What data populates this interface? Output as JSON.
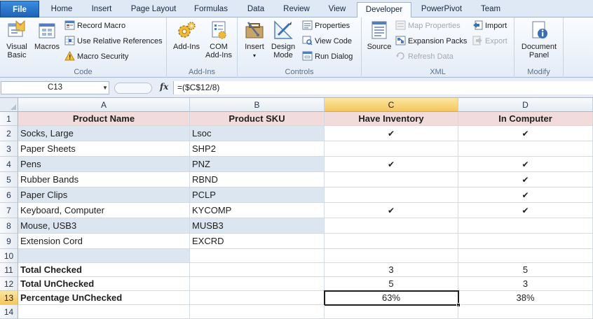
{
  "tabs": [
    "File",
    "Home",
    "Insert",
    "Page Layout",
    "Formulas",
    "Data",
    "Review",
    "View",
    "Developer",
    "PowerPivot",
    "Team"
  ],
  "active_tab": "Developer",
  "ribbon": {
    "code": {
      "label": "Code",
      "visual_basic": "Visual Basic",
      "visual_basic_line1": "Visual",
      "visual_basic_line2": "Basic",
      "macros": "Macros",
      "record_macro": "Record Macro",
      "use_relative": "Use Relative References",
      "macro_security": "Macro Security"
    },
    "addins": {
      "label": "Add-Ins",
      "addins": "Add-Ins",
      "com_line1": "COM",
      "com_line2": "Add-Ins"
    },
    "controls": {
      "label": "Controls",
      "insert": "Insert",
      "design_line1": "Design",
      "design_line2": "Mode",
      "properties": "Properties",
      "view_code": "View Code",
      "run_dialog": "Run Dialog"
    },
    "xml": {
      "label": "XML",
      "source": "Source",
      "map_properties": "Map Properties",
      "expansion_packs": "Expansion Packs",
      "refresh_data": "Refresh Data",
      "import": "Import",
      "export": "Export"
    },
    "modify": {
      "label": "Modify",
      "doc_line1": "Document",
      "doc_line2": "Panel"
    }
  },
  "formula_bar": {
    "name_box": "C13",
    "fx": "fx",
    "formula": "=($C$12/8)"
  },
  "sheet": {
    "columns": [
      "A",
      "B",
      "C",
      "D"
    ],
    "selected_column": "C",
    "selected_row": "13",
    "row_numbers": [
      "1",
      "2",
      "3",
      "4",
      "5",
      "6",
      "7",
      "8",
      "9",
      "10",
      "11",
      "12",
      "13",
      "14"
    ],
    "headers": [
      "Product Name",
      "Product SKU",
      "Have Inventory",
      "In Computer"
    ],
    "rows": [
      {
        "name": "Socks, Large",
        "sku": "Lsoc",
        "inv": "✔",
        "comp": "✔"
      },
      {
        "name": "Paper Sheets",
        "sku": "SHP2",
        "inv": "",
        "comp": ""
      },
      {
        "name": "Pens",
        "sku": "PNZ",
        "inv": "✔",
        "comp": "✔"
      },
      {
        "name": "Rubber Bands",
        "sku": "RBND",
        "inv": "",
        "comp": "✔"
      },
      {
        "name": "Paper Clips",
        "sku": "PCLP",
        "inv": "",
        "comp": "✔"
      },
      {
        "name": "Keyboard, Computer",
        "sku": "KYCOMP",
        "inv": "✔",
        "comp": "✔"
      },
      {
        "name": "Mouse, USB3",
        "sku": "MUSB3",
        "inv": "",
        "comp": ""
      },
      {
        "name": "Extension Cord",
        "sku": "EXCRD",
        "inv": "",
        "comp": ""
      }
    ],
    "summary": [
      {
        "label": "Total Checked",
        "c": "3",
        "d": "5"
      },
      {
        "label": "Total UnChecked",
        "c": "5",
        "d": "3"
      },
      {
        "label": "Percentage UnChecked",
        "c": "63%",
        "d": "38%"
      }
    ]
  },
  "colors": {
    "band": "#dce6f1",
    "header_fill": "#f2dcdb",
    "file_tab": "#2a72c9",
    "selection_header": "#f5c65e"
  }
}
